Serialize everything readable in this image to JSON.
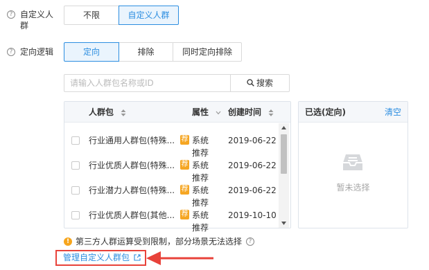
{
  "custom_crowd": {
    "label": "自定义人群",
    "help_icon": "question-circle-icon",
    "options": [
      "不限",
      "自定义人群"
    ],
    "selected": "自定义人群"
  },
  "logic": {
    "label": "定向逻辑",
    "help_icon": "question-circle-icon",
    "options": [
      "定向",
      "排除",
      "同时定向排除"
    ],
    "selected": "定向"
  },
  "search": {
    "placeholder": "请输入人群包名称或ID",
    "button_label": "搜索",
    "button_icon": "search-icon"
  },
  "table": {
    "columns": [
      "人群包",
      "属性",
      "创建时间"
    ],
    "rows": [
      {
        "name": "行业通用人群包(特殊...",
        "tag": "荐",
        "attr": "系统推荐",
        "date": "2019-06-22"
      },
      {
        "name": "行业优质人群包(特殊...",
        "tag": "荐",
        "attr": "系统推荐",
        "date": "2019-06-22"
      },
      {
        "name": "行业潜力人群包(特殊...",
        "tag": "荐",
        "attr": "系统推荐",
        "date": "2019-06-22"
      },
      {
        "name": "行业优质人群包(其他...",
        "tag": "荐",
        "attr": "系统推荐",
        "date": "2019-10-10"
      }
    ]
  },
  "selected_panel": {
    "title": "已选(定向)",
    "clear_label": "清空",
    "empty_text": "暂未选择",
    "empty_icon": "inbox-icon"
  },
  "warning": {
    "text": "第三方人群运算受到限制，部分场景无法选择",
    "icon": "exclamation-circle-icon"
  },
  "manage_link": {
    "label": "管理自定义人群包",
    "icon": "external-link-icon"
  },
  "colors": {
    "accent": "#2b8de0",
    "warning": "#f7a51c",
    "tag": "#f5a623",
    "annotation": "#e8423a"
  }
}
